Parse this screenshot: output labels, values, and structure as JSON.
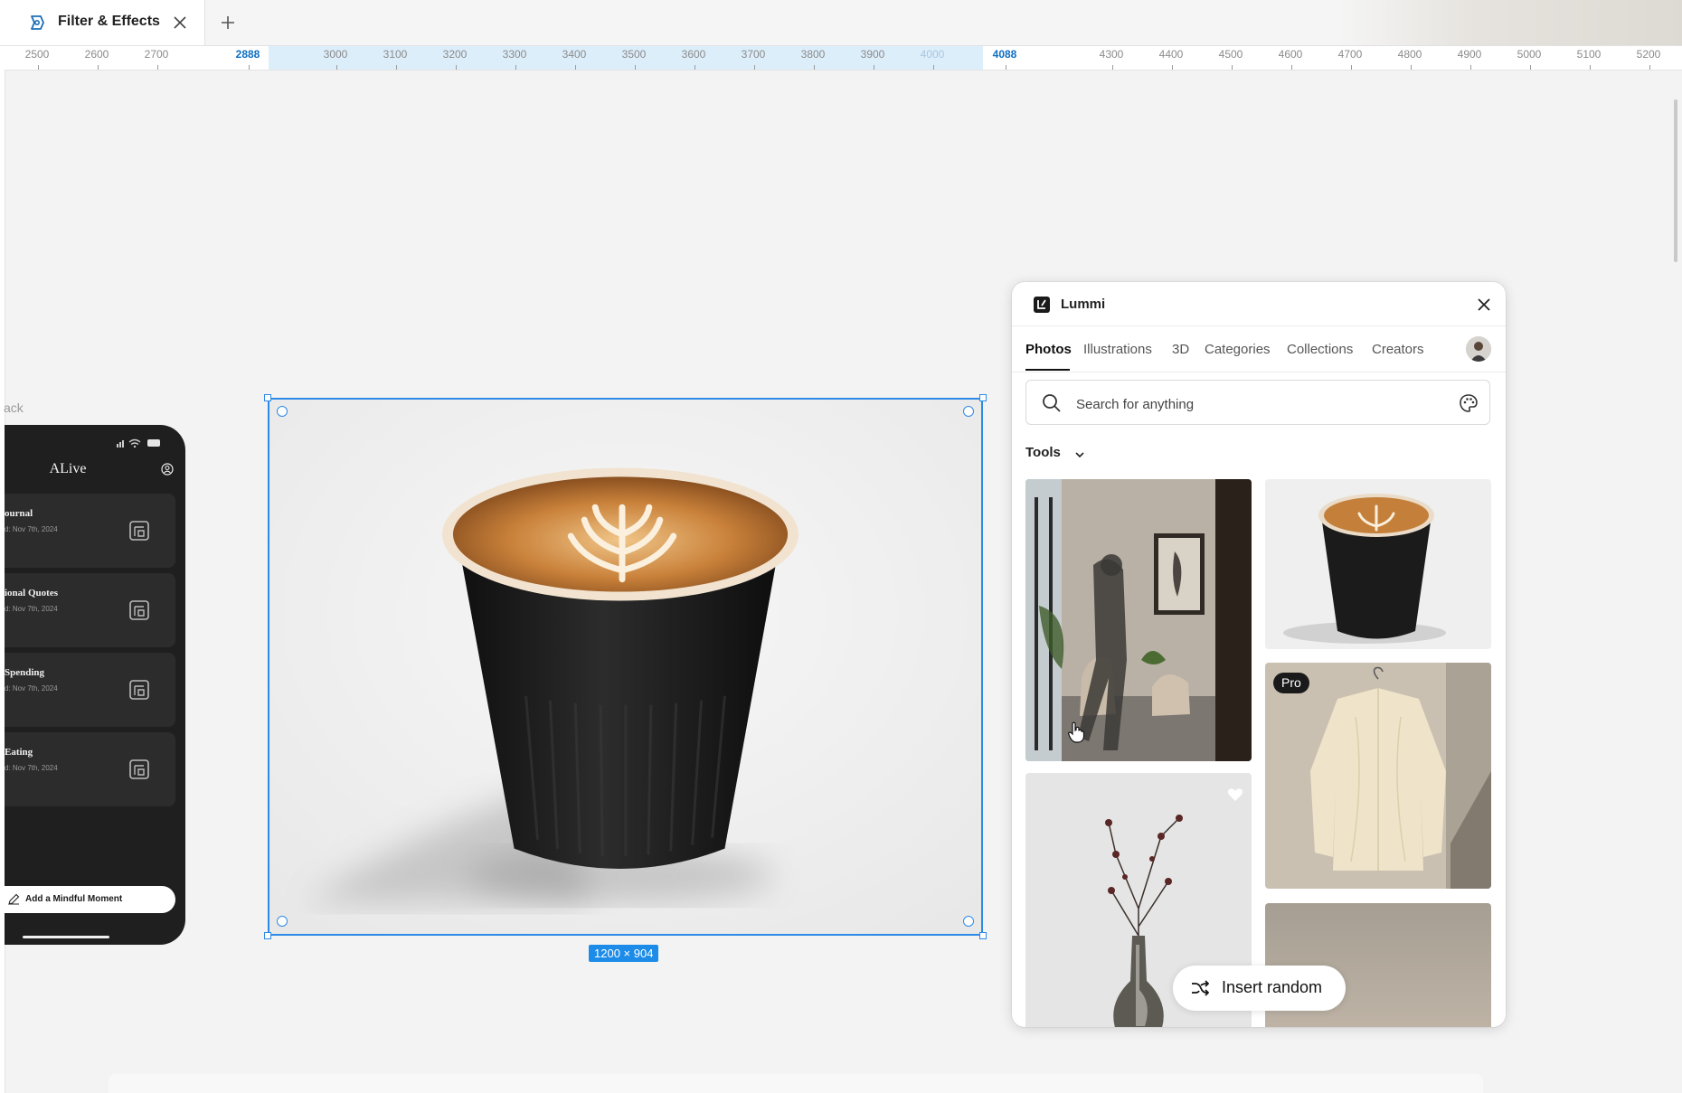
{
  "tab": {
    "title": "Filter & Effects"
  },
  "ruler": {
    "labels": [
      "2500",
      "2600",
      "2700",
      "2888",
      "3000",
      "3100",
      "3200",
      "3300",
      "3400",
      "3500",
      "3600",
      "3700",
      "3800",
      "3900",
      "4000",
      "4088",
      "4300",
      "4400",
      "4500",
      "4600",
      "4700",
      "4800",
      "4900",
      "5000",
      "5100",
      "5200"
    ],
    "selection_start_label": "2888",
    "selection_end_label": "4088"
  },
  "phone": {
    "back_label": "ack",
    "app_title": "ALive",
    "cards": [
      {
        "title": "ournal",
        "date": "d: Nov 7th, 2024"
      },
      {
        "title": "ional Quotes",
        "date": "d: Nov 7th, 2024"
      },
      {
        "title": "Spending",
        "date": "d: Nov 7th, 2024"
      },
      {
        "title": "Eating",
        "date": "d: Nov 7th, 2024"
      }
    ],
    "button_label": "Add a Mindful Moment"
  },
  "selection": {
    "size_label": "1200 × 904"
  },
  "panel": {
    "title": "Lummi",
    "tabs": [
      {
        "label": "Photos",
        "active": true
      },
      {
        "label": "Illustrations"
      },
      {
        "label": "3D"
      },
      {
        "label": "Categories"
      },
      {
        "label": "Collections"
      },
      {
        "label": "Creators"
      }
    ],
    "search": {
      "placeholder": "Search for anything"
    },
    "tools_label": "Tools",
    "pro_badge": "Pro",
    "insert_label": "Insert random"
  },
  "icons": [
    "figma-plugin-icon",
    "close-icon",
    "plus-icon",
    "search-icon",
    "palette-icon",
    "chevron-down-icon",
    "heart-icon",
    "shuffle-icon",
    "profile-icon",
    "journal-icon",
    "pencil-icon",
    "hand-cursor-icon"
  ],
  "colors": {
    "selection_blue": "#2d8ae6",
    "badge_blue": "#1d8ce8",
    "ruler_selected": "#0d6fc2"
  }
}
